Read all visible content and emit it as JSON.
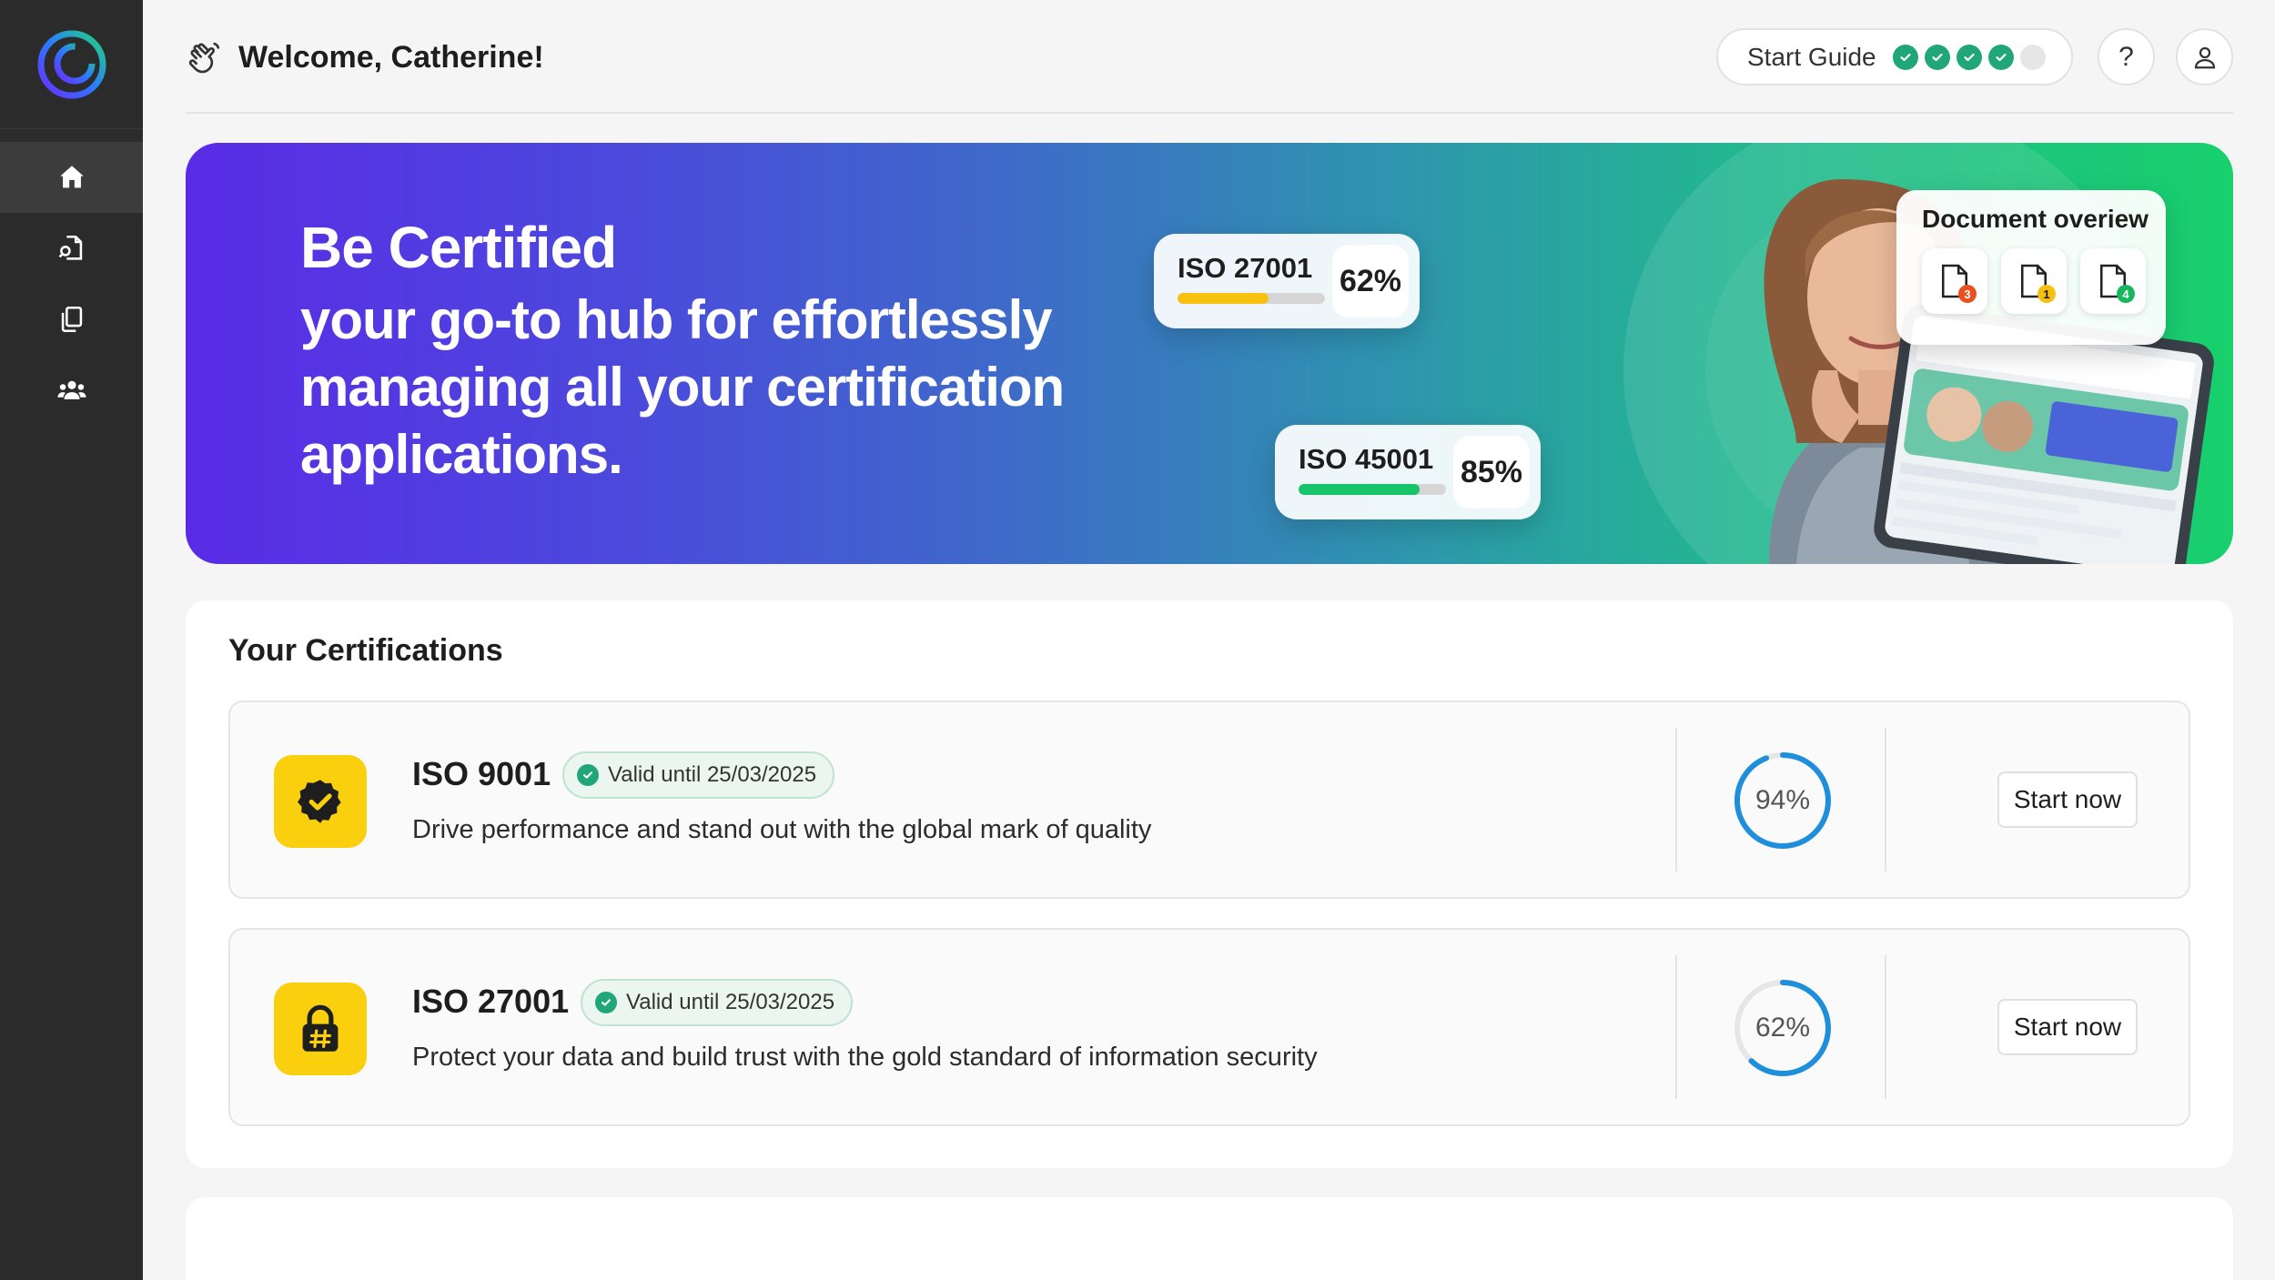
{
  "header": {
    "welcome": "Welcome, Catherine!",
    "start_guide_label": "Start Guide",
    "guide_steps": [
      "done",
      "done",
      "done",
      "done",
      "todo"
    ],
    "help_label": "?"
  },
  "sidebar": {
    "items": [
      {
        "icon": "home-icon",
        "active": true
      },
      {
        "icon": "certificate-search-icon",
        "active": false
      },
      {
        "icon": "documents-icon",
        "active": false
      },
      {
        "icon": "team-icon",
        "active": false
      }
    ]
  },
  "banner": {
    "title": "Be Certified",
    "subtitle": "your go-to hub for effortlessly managing all your certification applications.",
    "cards": [
      {
        "name": "ISO 27001",
        "percent": "62%",
        "progress": 0.62,
        "color": "#f6c20e"
      },
      {
        "name": "ISO 45001",
        "percent": "85%",
        "progress": 0.82,
        "color": "#18c46a"
      }
    ],
    "doc_overview": {
      "title": "Document overiew",
      "badges": [
        {
          "count": "3",
          "color": "#e8501f"
        },
        {
          "count": "1",
          "color": "#f5c010"
        },
        {
          "count": "4",
          "color": "#18b75e"
        }
      ]
    }
  },
  "certifications": {
    "title": "Your Certifications",
    "items": [
      {
        "name": "ISO 9001",
        "valid": "Valid until 25/03/2025",
        "description": "Drive performance and stand out with the global mark of quality",
        "progress_label": "94%",
        "progress": 0.94,
        "action": "Start now",
        "icon": "badge-check-icon"
      },
      {
        "name": "ISO 27001",
        "valid": "Valid until 25/03/2025",
        "description": "Protect your data and build trust with the gold standard of information security",
        "progress_label": "62%",
        "progress": 0.62,
        "action": "Start now",
        "icon": "lock-icon"
      }
    ]
  },
  "colors": {
    "accent_green": "#21a67a",
    "ring_blue": "#1f8fdc",
    "cert_icon_yellow": "#f9cf0e",
    "sidebar_bg": "#2b2b2b"
  }
}
